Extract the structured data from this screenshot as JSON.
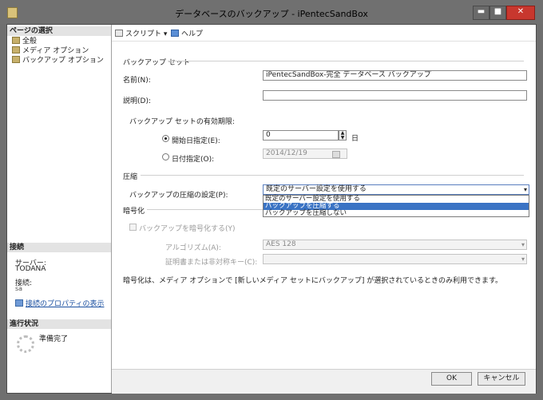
{
  "window": {
    "title": "データベースのバックアップ - iPentecSandBox",
    "min_glyph": "▬",
    "max_glyph": "■",
    "close_glyph": "✕"
  },
  "left": {
    "select_page_header": "ページの選択",
    "nav": [
      "全般",
      "メディア オプション",
      "バックアップ オプション"
    ],
    "connection_header": "接続",
    "server_label": "サーバー:",
    "server_value": "TODANA",
    "conn_label": "接続:",
    "conn_value": "sa",
    "conn_props_link": "接続のプロパティの表示",
    "progress_header": "進行状況",
    "progress_status": "準備完了"
  },
  "toolbar": {
    "script_label": "スクリプト",
    "script_arrow": "▾",
    "help_label": "ヘルプ"
  },
  "form": {
    "backup_set_section": "バックアップ セット",
    "name_label": "名前(N):",
    "name_value": "iPentecSandBox-完全 データベース バックアップ",
    "desc_label": "説明(D):",
    "desc_value": "",
    "expire_label": "バックアップ セットの有効期限:",
    "after_label": "開始日指定(E):",
    "after_value": "0",
    "days_unit": "日",
    "on_label": "日付指定(O):",
    "on_value": "2014/12/19",
    "compression_section": "圧縮",
    "compression_label": "バックアップの圧縮の設定(P):",
    "compression_selected": "既定のサーバー設定を使用する",
    "compression_options": [
      "既定のサーバー設定を使用する",
      "バックアップを圧縮する",
      "バックアップを圧縮しない"
    ],
    "compression_highlighted_index": 1,
    "encryption_section": "暗号化",
    "encrypt_check_label": "バックアップを暗号化する(Y)",
    "algorithm_label": "アルゴリズム(A):",
    "algorithm_value": "AES 128",
    "cert_label": "証明書または非対称キー(C):",
    "cert_value": "",
    "encrypt_note": "暗号化は、メディア オプションで [新しいメディア セットにバックアップ] が選択されているときのみ利用できます。"
  },
  "buttons": {
    "ok": "OK",
    "cancel": "キャンセル"
  },
  "colors": {
    "title_bg": "#707070",
    "close_red": "#c8372e",
    "highlight": "#3a73c4"
  }
}
